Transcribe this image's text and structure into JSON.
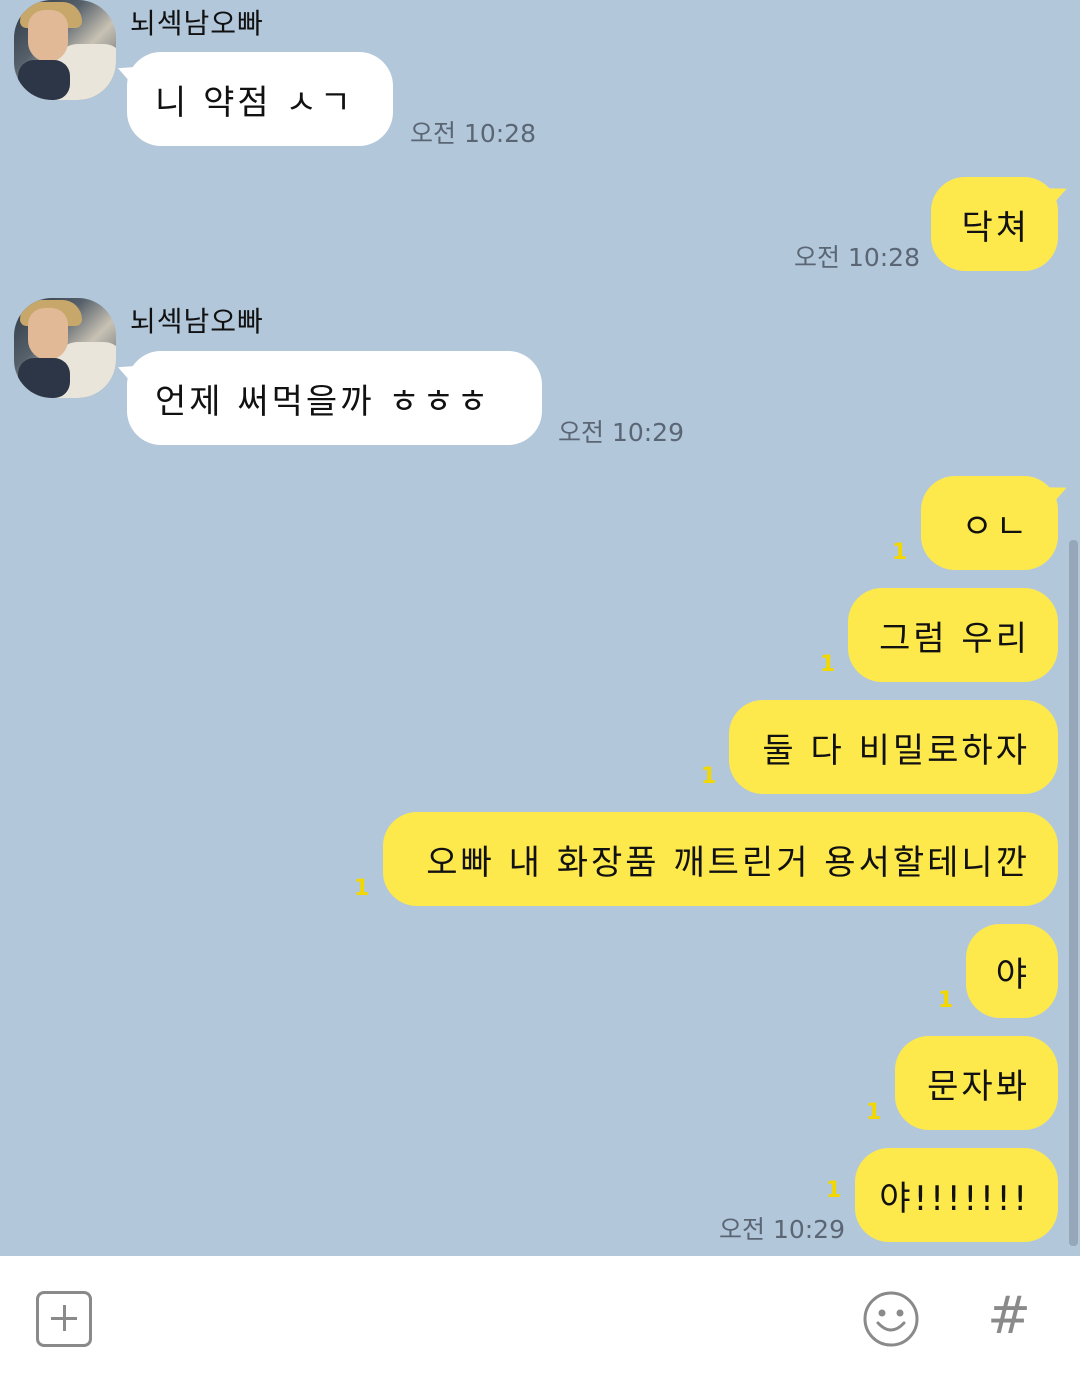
{
  "chat": {
    "messages": [
      {
        "direction": "in",
        "sender": "뇌섹남오빠",
        "text": "니 약점 ㅅㄱ",
        "time": "오전 10:28"
      },
      {
        "direction": "out",
        "text": "닥쳐",
        "time": "오전 10:28"
      },
      {
        "direction": "in",
        "sender": "뇌섹남오빠",
        "text": "언제 써먹을까 ㅎㅎㅎ",
        "time": "오전 10:29"
      },
      {
        "direction": "out",
        "text": "ㅇㄴ",
        "unread": "1"
      },
      {
        "direction": "out",
        "text": "그럼 우리",
        "unread": "1"
      },
      {
        "direction": "out",
        "text": "둘 다 비밀로하자",
        "unread": "1"
      },
      {
        "direction": "out",
        "text": "오빠 내 화장품 깨트린거 용서할테니깐",
        "unread": "1"
      },
      {
        "direction": "out",
        "text": "야",
        "unread": "1"
      },
      {
        "direction": "out",
        "text": "문자봐",
        "unread": "1"
      },
      {
        "direction": "out",
        "text": "야!!!!!!!",
        "unread": "1",
        "time": "오전 10:29"
      }
    ]
  },
  "input_bar": {
    "icons": [
      "plus-icon",
      "emoji-icon",
      "hashtag-icon"
    ],
    "hashtag_glyph": "#"
  },
  "colors": {
    "background": "#b2c7da",
    "incoming_bubble": "#ffffff",
    "outgoing_bubble": "#fee94d",
    "unread_count": "#f2d800"
  }
}
